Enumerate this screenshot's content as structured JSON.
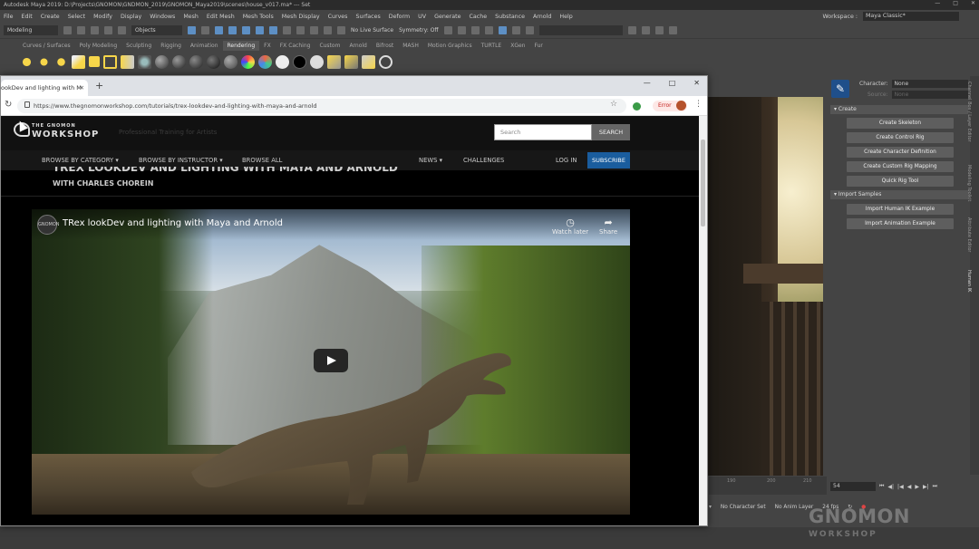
{
  "maya": {
    "title": "Autodesk Maya 2019: D:\\Projects\\GNOMON\\GNDMON_2019\\GNOMON_Maya2019\\scenes\\house_v017.ma* --- Set",
    "menu": [
      "File",
      "Edit",
      "Create",
      "Select",
      "Modify",
      "Display",
      "Windows",
      "Mesh",
      "Edit Mesh",
      "Mesh Tools",
      "Mesh Display",
      "Curves",
      "Surfaces",
      "Deform",
      "UV",
      "Generate",
      "Cache",
      "Substance",
      "Arnold",
      "Help"
    ],
    "workspace_label": "Workspace :",
    "workspace_value": "Maya Classic*",
    "mode": "Modeling",
    "objects": "Objects",
    "live_surface": "No Live Surface",
    "symmetry": "Symmetry: Off",
    "shelf_tabs": [
      "Curves / Surfaces",
      "Poly Modeling",
      "Sculpting",
      "Rigging",
      "Animation",
      "Rendering",
      "FX",
      "FX Caching",
      "Custom",
      "Arnold",
      "Bifrost",
      "MASH",
      "Motion Graphics",
      "TURTLE",
      "XGen",
      "Fur"
    ],
    "active_shelf": "Rendering",
    "hik": {
      "character_label": "Character:",
      "character_value": "None",
      "source_label": "Source:",
      "source_value": "None",
      "section_create": "Create",
      "buttons_create": [
        "Create Skeleton",
        "Create Control Rig",
        "Create Character Definition",
        "Create Custom Rig Mapping",
        "Quick Rig Tool"
      ],
      "section_import": "Import Samples",
      "buttons_import": [
        "Import Human IK Example",
        "Import Animation Example"
      ]
    },
    "side_tabs": [
      "Channel Box / Layer Editor",
      "Modeling Toolkit",
      "Attribute Editor",
      "Human IK"
    ],
    "timeline_ticks": [
      "190",
      "200",
      "210"
    ],
    "current_frame": "54",
    "no_character_set": "No Character Set",
    "no_anim_layer": "No Anim Layer",
    "fps": "24 fps"
  },
  "watermark": {
    "line1": "GNOMON",
    "line2": "WORKSHOP"
  },
  "browser": {
    "tab_title": "ookDev and lighting with M",
    "url": "https://www.thegnomonworkshop.com/tutorials/trex-lookdev-and-lighting-with-maya-and-arnold",
    "error_label": "Error"
  },
  "site": {
    "logo_line1": "THE GNOMON",
    "logo_line2": "WORKSHOP",
    "tagline": "Professional Training for Artists",
    "search_placeholder": "Search",
    "search_button": "SEARCH",
    "nav": {
      "browse_category": "BROWSE BY CATEGORY",
      "browse_instructor": "BROWSE BY INSTRUCTOR",
      "browse_all": "BROWSE ALL",
      "news": "NEWS",
      "challenges": "CHALLENGES",
      "login": "LOG IN",
      "subscribe": "SUBSCRIBE"
    },
    "course_title": "TREX LOOKDEV AND LIGHTING WITH MAYA AND ARNOLD",
    "course_author": "WITH CHARLES CHOREIN"
  },
  "video": {
    "title": "TRex lookDev and lighting with Maya and Arnold",
    "watch_later": "Watch later",
    "share": "Share",
    "channel_badge": "GNOMON"
  }
}
